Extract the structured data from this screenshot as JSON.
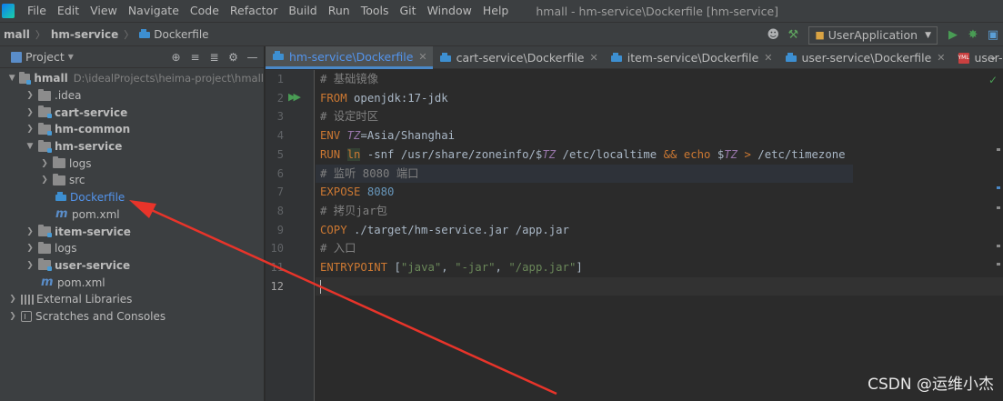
{
  "menubar": {
    "items": [
      "File",
      "Edit",
      "View",
      "Navigate",
      "Code",
      "Refactor",
      "Build",
      "Run",
      "Tools",
      "Git",
      "Window",
      "Help"
    ],
    "window_title": "hmall - hm-service\\Dockerfile [hm-service]"
  },
  "breadcrumb": {
    "items": [
      "mall",
      "hm-service"
    ],
    "file": "Dockerfile"
  },
  "toolbar": {
    "run_config": "UserApplication"
  },
  "project_panel": {
    "title": "Project",
    "tree": {
      "root": {
        "label": "hmall",
        "path": "D:\\idealProjects\\heima-project\\hmall"
      },
      "idea": ".idea",
      "cart_service": "cart-service",
      "hm_common": "hm-common",
      "hm_service": "hm-service",
      "logs_inner": "logs",
      "src": "src",
      "dockerfile": "Dockerfile",
      "pom_inner": "pom.xml",
      "item_service": "item-service",
      "logs": "logs",
      "user_service": "user-service",
      "pom": "pom.xml",
      "external_libraries": "External Libraries",
      "scratches": "Scratches and Consoles"
    }
  },
  "tabs": [
    {
      "label": "hm-service\\Dockerfile",
      "active": true
    },
    {
      "label": "cart-service\\Dockerfile",
      "active": false
    },
    {
      "label": "item-service\\Dockerfile",
      "active": false
    },
    {
      "label": "user-service\\Dockerfile",
      "active": false
    },
    {
      "label": "user-servi",
      "active": false
    }
  ],
  "editor": {
    "line_numbers": [
      "1",
      "2",
      "3",
      "4",
      "5",
      "6",
      "7",
      "8",
      "9",
      "10",
      "11",
      "12"
    ],
    "lines": {
      "l1_comment": "# 基础镜像",
      "l2_kw": "FROM",
      "l2_val": " openjdk:17-jdk",
      "l3_comment": "# 设定时区",
      "l4_kw": "ENV",
      "l4_var": "TZ",
      "l4_rest": "=Asia/Shanghai",
      "l5_kw": "RUN",
      "l5_ln": "ln",
      "l5_a": " -snf /usr/share/zoneinfo/$",
      "l5_var1": "TZ",
      "l5_b": " /etc/localtime ",
      "l5_and": "&&",
      "l5_echo": "echo",
      "l5_c": " $",
      "l5_var2": "TZ",
      "l5_gt": ">",
      "l5_d": " /etc/timezone",
      "l6_comment": "# 监听 8080 端口",
      "l7_kw": "EXPOSE",
      "l7_num": "8080",
      "l8_comment": "# 拷贝jar包",
      "l9_kw": "COPY",
      "l9_val": " ./target/hm-service.jar /app.jar",
      "l10_comment": "# 入口",
      "l11_kw": "ENTRYPOINT",
      "l11_open": " [",
      "l11_s1": "\"java\"",
      "l11_c1": ", ",
      "l11_s2": "\"-jar\"",
      "l11_c2": ", ",
      "l11_s3": "\"/app.jar\"",
      "l11_close": "]"
    }
  },
  "watermark": "CSDN @运维小杰",
  "colors": {
    "accent": "#4a88c7",
    "arrow": "#e8342a"
  }
}
